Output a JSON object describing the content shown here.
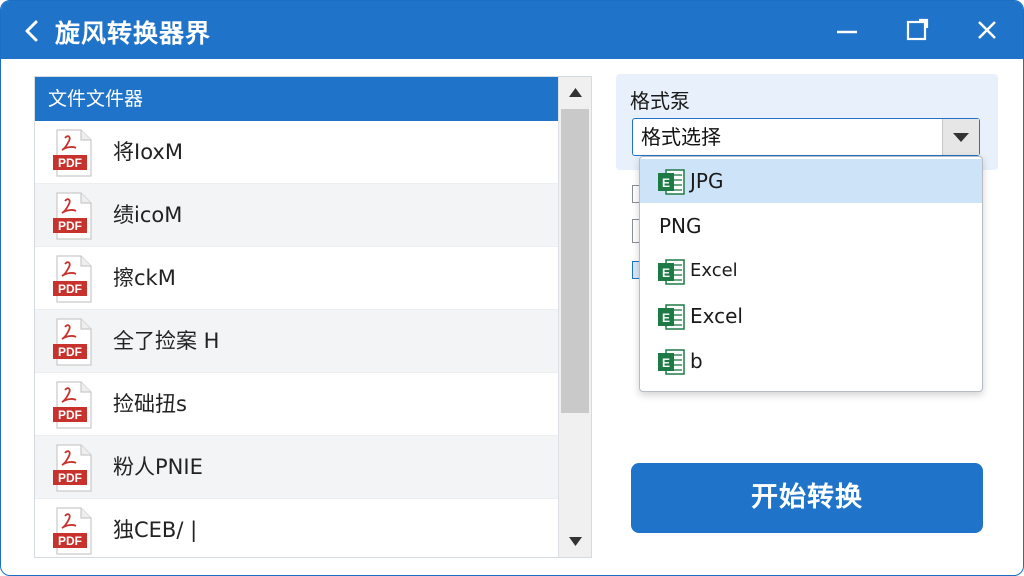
{
  "window": {
    "title": "旋风转换器界"
  },
  "file_panel": {
    "header": "文件文件器",
    "file_type_label": "PDF",
    "files": [
      {
        "name": "将IoxM"
      },
      {
        "name": "绩icoM"
      },
      {
        "name": "擦ckM"
      },
      {
        "name": "全了捡案 H"
      },
      {
        "name": "捡础扭s"
      },
      {
        "name": "粉人PNIE"
      },
      {
        "name": "独CEB/ |"
      }
    ]
  },
  "format": {
    "label": "格式泵",
    "select_value": "格式选择",
    "options": [
      {
        "label": "JPG",
        "icon": "excel-icon",
        "selected": true
      },
      {
        "label": "PNG",
        "icon": "",
        "selected": false
      },
      {
        "label": "Excel",
        "icon": "excel-icon",
        "selected": false
      },
      {
        "label": "Excel",
        "icon": "excel-icon",
        "selected": false
      },
      {
        "label": "b",
        "icon": "excel-icon",
        "selected": false
      }
    ]
  },
  "actions": {
    "start_label": "开始转换"
  },
  "colors": {
    "accent": "#1f73c9",
    "pdf_red": "#c8322d",
    "excel_green": "#1e7a45",
    "selected_row": "#cde3f7"
  }
}
